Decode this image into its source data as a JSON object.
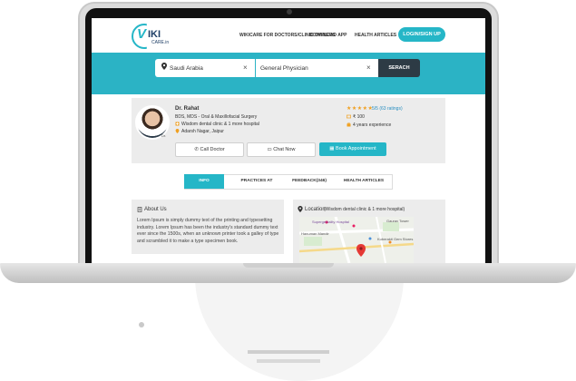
{
  "header": {
    "logo_v": "V",
    "logo_iki": "IKI",
    "logo_care": "CARE.in",
    "nav": [
      "WIKICARE FOR DOCTORS/CLINIC OWNERS",
      "DOWNLOAD APP",
      "HEALTH ARTICLES"
    ],
    "login_label": "LOGIN/SIGN UP"
  },
  "search": {
    "location_value": "Saudi Arabia",
    "specialty_value": "General Physician",
    "search_label": "SERACH",
    "clear_symbol": "×"
  },
  "doctor": {
    "name": "Dr. Rahat",
    "qualification": "BDS, MDS - Oral & Maxillofacial Surgery",
    "clinic": "Wisdom dental clinic & 1 more hospital",
    "address": "Adarsh Nagar, Jaipur",
    "badge": "Dr.",
    "rating_stars": "★★★★★",
    "rating_text": "5/5 (63 ratings)",
    "fee": "₹ 100",
    "experience": "4 years experience",
    "call_label": "Call Doctor",
    "chat_label": "Chat Now",
    "book_label": "Book Appointment"
  },
  "tabs": [
    "INFO",
    "PRACTICES AT",
    "FEEDBACK(346)",
    "HEALTH ARTICLES"
  ],
  "about": {
    "title": "About Us",
    "text": "Lorem Ipsum is simply dummy text of the printing and typesetting industry. Lorem Ipsum has been the industry's standard dummy text ever since the 1500s, when an unknown printer took a galley of type and scrambled it to make a type specimen book."
  },
  "location": {
    "title": "Location",
    "subtitle": "(Wisdom dental clinic & 1 more hospital)",
    "map_labels": [
      "Supergeniality Hospital",
      "Hanuman Mandir",
      "Gaurav Tower",
      "Kuberakti Gem Stores"
    ]
  },
  "colors": {
    "accent": "#25b6c7",
    "dark_button": "#2d3b45",
    "star": "#f0a020",
    "panel_bg": "#ececec"
  }
}
